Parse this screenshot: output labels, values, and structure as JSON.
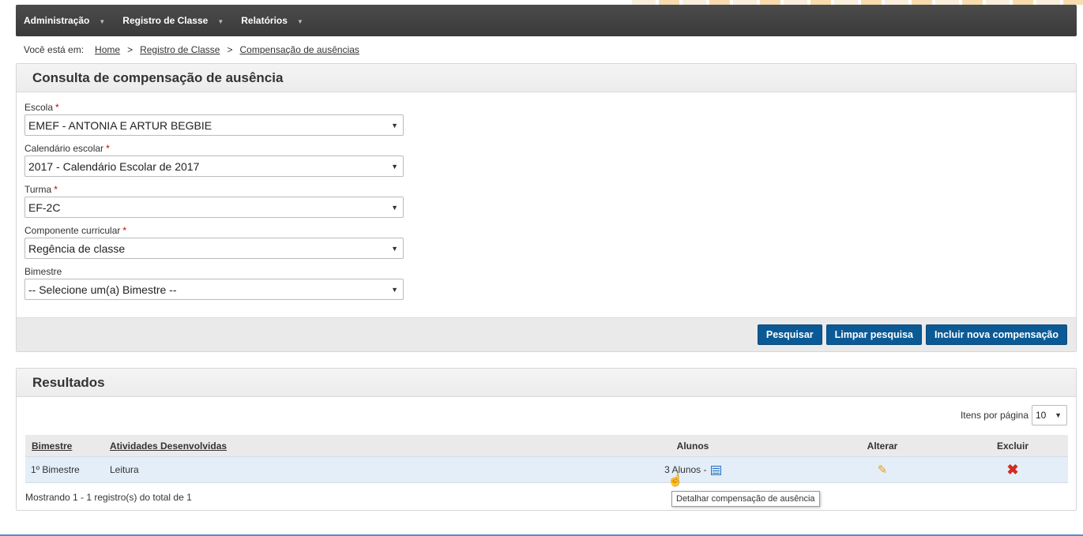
{
  "nav": {
    "items": [
      {
        "label": "Administração"
      },
      {
        "label": "Registro de Classe"
      },
      {
        "label": "Relatórios"
      }
    ]
  },
  "breadcrumb": {
    "prefix": "Você está em:",
    "items": [
      "Home",
      "Registro de Classe",
      "Compensação de ausências"
    ],
    "separator": ">"
  },
  "consulta": {
    "title": "Consulta de compensação de ausência",
    "fields": [
      {
        "label": "Escola",
        "required": "*",
        "value": "EMEF - ANTONIA E ARTUR BEGBIE"
      },
      {
        "label": "Calendário escolar",
        "required": "*",
        "value": "2017 - Calendário Escolar de 2017"
      },
      {
        "label": "Turma",
        "required": "*",
        "value": "EF-2C"
      },
      {
        "label": "Componente curricular",
        "required": "*",
        "value": "Regência de classe"
      },
      {
        "label": "Bimestre",
        "required": "",
        "value": "-- Selecione um(a) Bimestre --"
      }
    ],
    "buttons": {
      "search": "Pesquisar",
      "clear": "Limpar pesquisa",
      "add": "Incluir nova compensação"
    }
  },
  "resultados": {
    "title": "Resultados",
    "per_page_label": "Itens por página",
    "per_page_value": "10",
    "columns": [
      "Bimestre",
      "Atividades Desenvolvidas",
      "Alunos",
      "Alterar",
      "Excluir"
    ],
    "rows": [
      {
        "bimestre": "1º Bimestre",
        "atividades": "Leitura",
        "alunos": "3 Alunos -"
      }
    ],
    "summary": "Mostrando 1 - 1 registro(s) do total de 1"
  },
  "tooltip": "Detalhar compensação de ausência",
  "colors": {
    "navbar": "#3f3f3f",
    "button": "#0b5a95",
    "row_highlight": "#e4eef8",
    "required": "#cc0000",
    "delete": "#d42a20",
    "edit": "#e3a21a"
  },
  "icons": {
    "dropdown": "triangle-down-icon",
    "detail": "detail-list-icon",
    "edit": "pencil-icon",
    "delete": "x-icon",
    "cursor": "hand-cursor-icon"
  }
}
